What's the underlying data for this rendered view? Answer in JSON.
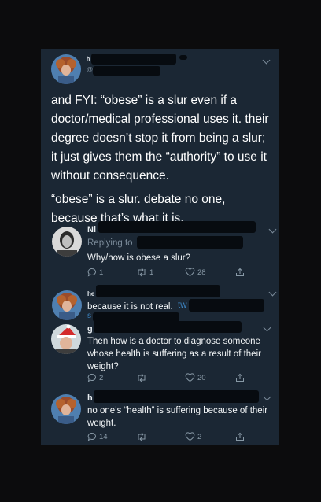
{
  "main_tweet": {
    "name": "h",
    "handle": "@",
    "paragraph_1": "and FYI: “obese” is a slur even if a doctor/medical professional uses it. their degree doesn’t stop it from being a slur; it just gives them the “authority” to use it without consequence.",
    "paragraph_2": "“obese” is a slur. debate no one, because that’s what it is."
  },
  "replies": [
    {
      "name": "Ni",
      "replying_to": "Replying to",
      "text": "Why/how is obese a slur?",
      "comments": "1",
      "retweets": "1",
      "likes": "28"
    },
    {
      "name": "he",
      "text": "because it is not real.",
      "link_fragment": "tw",
      "link_fragment_2": "s"
    },
    {
      "name": "g",
      "text": "Then how is a doctor to diagnose someone whose health is suffering as a result of their weight?",
      "comments": "2",
      "retweets": "",
      "likes": "20"
    },
    {
      "name": "h",
      "text": "no one’s “health” is suffering because of their weight.",
      "comments": "14",
      "retweets": "",
      "likes": "2"
    }
  ],
  "icons": {
    "reply": "reply-icon",
    "retweet": "retweet-icon",
    "like": "heart-icon",
    "share": "share-icon",
    "more": "chevron-down-icon"
  },
  "colors": {
    "background": "#0c0c0d",
    "panel": "#1b2734",
    "muted": "#8899a6",
    "link": "#3c83c0"
  }
}
